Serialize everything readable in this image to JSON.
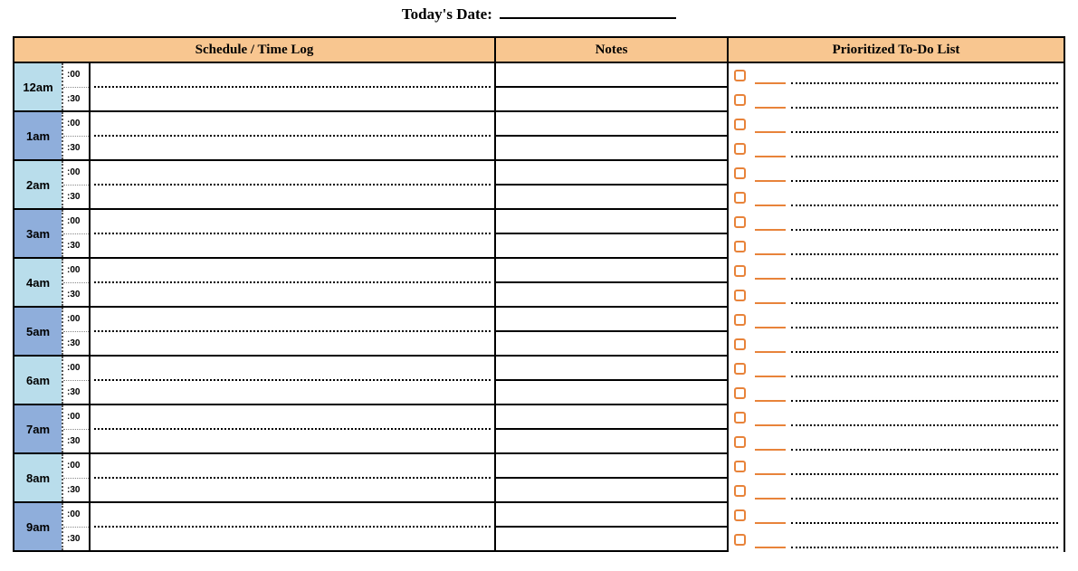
{
  "header": {
    "date_label": "Today's Date:"
  },
  "columns": {
    "schedule": "Schedule / Time Log",
    "notes": "Notes",
    "todo": "Prioritized To-Do List"
  },
  "minutes": {
    "top": ":00",
    "bottom": ":30"
  },
  "hours": [
    {
      "label": "12am",
      "shade": "lt"
    },
    {
      "label": "1am",
      "shade": "dk"
    },
    {
      "label": "2am",
      "shade": "lt"
    },
    {
      "label": "3am",
      "shade": "dk"
    },
    {
      "label": "4am",
      "shade": "lt"
    },
    {
      "label": "5am",
      "shade": "dk"
    },
    {
      "label": "6am",
      "shade": "lt"
    },
    {
      "label": "7am",
      "shade": "dk"
    },
    {
      "label": "8am",
      "shade": "lt"
    },
    {
      "label": "9am",
      "shade": "dk"
    }
  ],
  "note_rows": 20,
  "todo_rows": 20
}
